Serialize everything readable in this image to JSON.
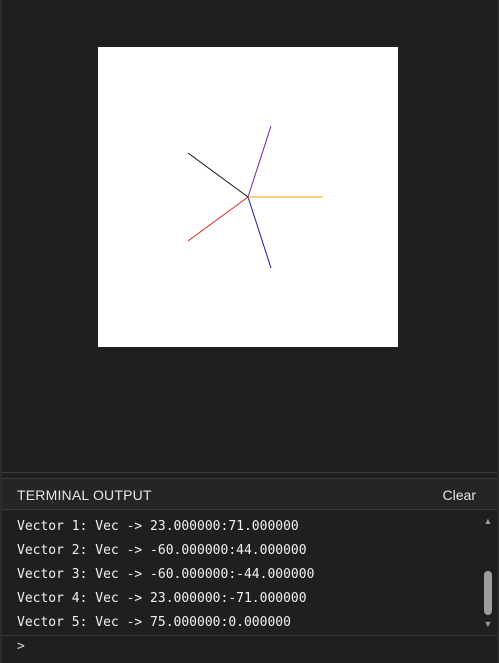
{
  "terminal": {
    "title": "TERMINAL OUTPUT",
    "clear_label": "Clear",
    "prompt": ">",
    "lines": [
      "Vector 1: Vec -> 23.000000:71.000000",
      "Vector 2: Vec -> -60.000000:44.000000",
      "Vector 3: Vec -> -60.000000:-44.000000",
      "Vector 4: Vec -> 23.000000:-71.000000",
      "Vector 5: Vec -> 75.000000:0.000000"
    ]
  },
  "vectors": [
    {
      "x": 23,
      "y": 71,
      "color": "#7a1fa2"
    },
    {
      "x": -60,
      "y": 44,
      "color": "#111111"
    },
    {
      "x": -60,
      "y": -44,
      "color": "#e02020"
    },
    {
      "x": 23,
      "y": -71,
      "color": "#1a1aa0"
    },
    {
      "x": 75,
      "y": 0,
      "color": "#f0a000"
    }
  ],
  "colors": {
    "background": "#1f1f1f",
    "canvas": "#ffffff",
    "header": "#252525",
    "text": "#e6e6e6"
  },
  "icons": {
    "scroll_up": "triangle-up",
    "scroll_down": "triangle-down"
  }
}
